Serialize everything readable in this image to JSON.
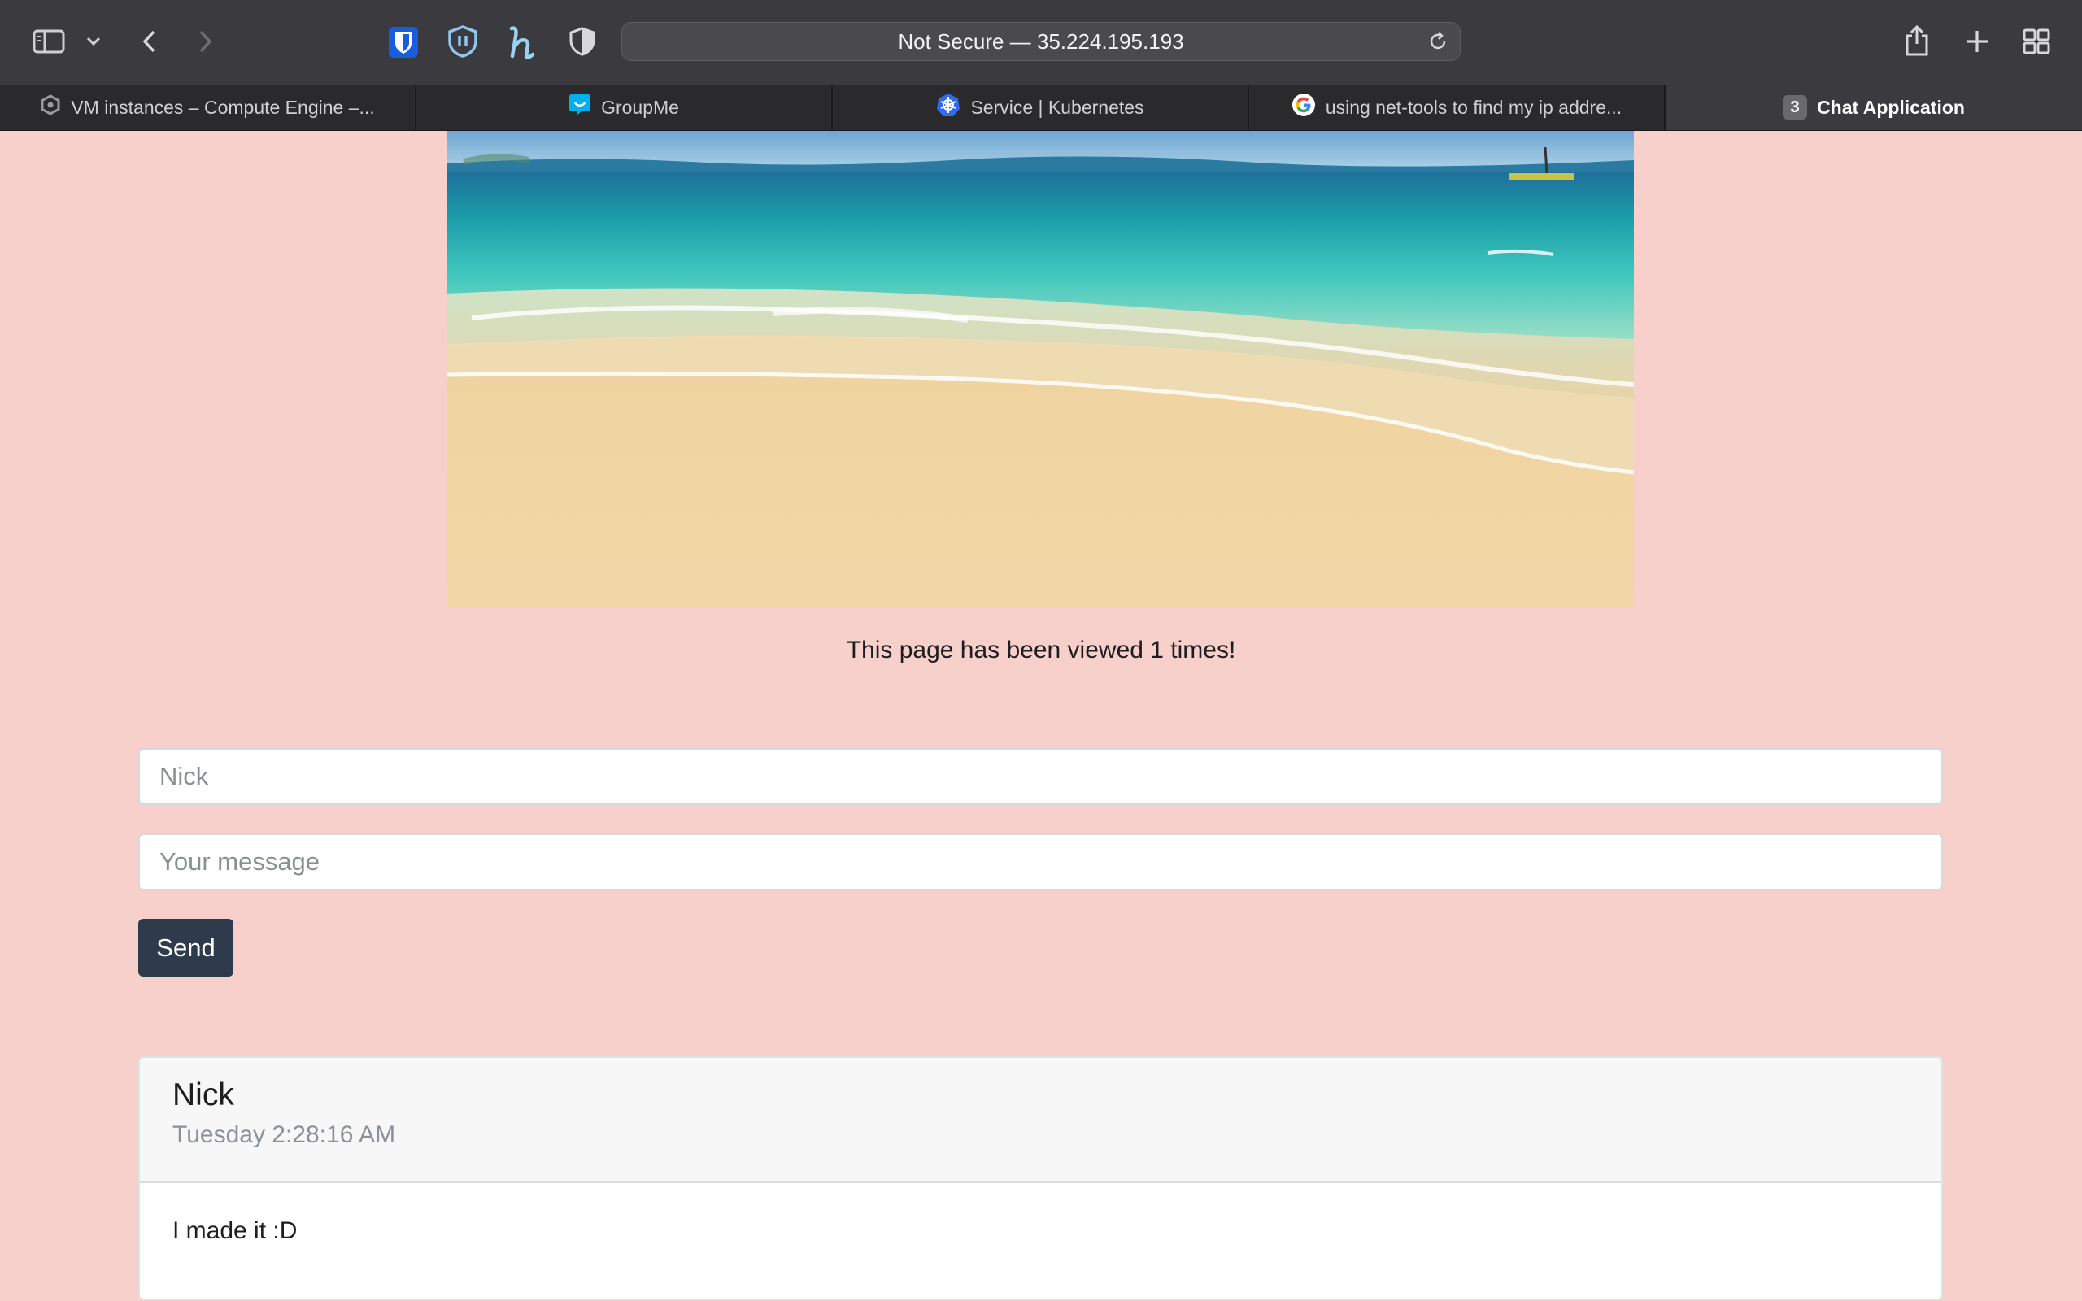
{
  "browser": {
    "address": "Not Secure — 35.224.195.193",
    "tabs": [
      {
        "label": "VM instances – Compute Engine –...",
        "icon": "gcp-icon",
        "active": false
      },
      {
        "label": "GroupMe",
        "icon": "groupme-icon",
        "active": false
      },
      {
        "label": "Service | Kubernetes",
        "icon": "kubernetes-icon",
        "active": false
      },
      {
        "label": "using net-tools to find my ip addre...",
        "icon": "google-icon",
        "active": false
      },
      {
        "label": "Chat Application",
        "count": "3",
        "active": true
      }
    ]
  },
  "page": {
    "view_counter": "This page has been viewed 1 times!",
    "name_input": {
      "value": "",
      "placeholder": "Nick"
    },
    "message_input": {
      "value": "",
      "placeholder": "Your message"
    },
    "send_label": "Send",
    "messages": [
      {
        "name": "Nick",
        "time": "Tuesday 2:28:16 AM",
        "text": "I made it :D"
      }
    ]
  },
  "colors": {
    "page_background": "#f7d0cb",
    "send_button": "#2e3b4c",
    "browser_toolbar": "#3b3a3f"
  }
}
